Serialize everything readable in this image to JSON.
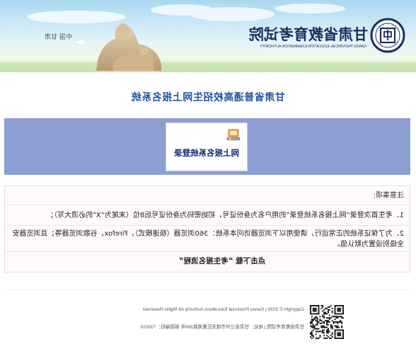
{
  "header": {
    "title": "甘肃省教育考试院",
    "subtitle_en": "GANSU PROVINCIAL EDUCATION EXAMINATION AUTHORITY",
    "region": "中国  甘肃"
  },
  "page_title": "甘肃省普通高校招生网上报名系统",
  "login": {
    "label": "网上报名系统登录",
    "icon": "computer-key-icon"
  },
  "notice": {
    "heading": "注意事项:",
    "items": [
      "1、考生首次登录“网上报名系统登录”的用户名为身份证号，初始密码为身份证号后8位（末尾为“X”的必须大写）；",
      "2、为了保证系统的正常运行，请使用以下浏览器访问本系统：360浏览器（极速模式），Firefox，谷歌浏览器等；且浏览器安全级别设置为默认值。"
    ],
    "download_prefix": "点击下载",
    "download_link": "“考生报名流程”"
  },
  "footer": {
    "copyright": "Copyright © 2020 | Gansu Provincial Educations Authority All Rights Reserved",
    "address": "甘肃省教育考试院 | 地址：甘肃省兰州市城关区雁滩路399号 邮政编码：730010",
    "qr_icon": "qr-code-icon"
  },
  "colors": {
    "title_blue": "#2156a6",
    "band": "#8c9fd3",
    "logo_navy": "#1c2f5e"
  }
}
